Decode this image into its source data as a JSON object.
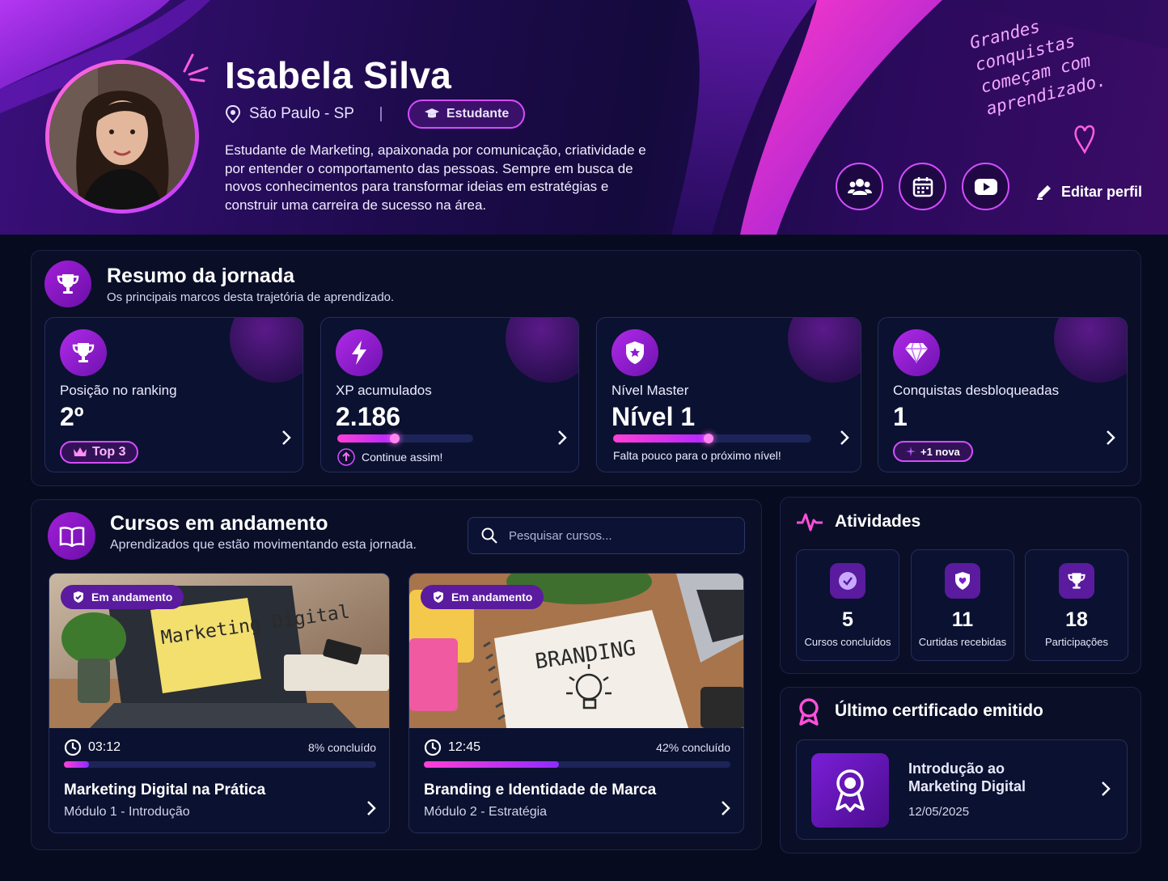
{
  "profile": {
    "name": "Isabela Silva",
    "location": "São Paulo - SP",
    "role_badge": "Estudante",
    "bio": "Estudante de Marketing, apaixonada por comunicação, criatividade e por entender o comportamento das pessoas. Sempre em busca de novos conhecimentos para transformar ideias em estratégias e construir uma carreira de sucesso na área.",
    "quote": "Grandes conquistas começam com aprendizado.",
    "edit_label": "Editar perfil",
    "actions": [
      "users-icon",
      "calendar-icon",
      "youtube-icon"
    ]
  },
  "summary": {
    "title": "Resumo da jornada",
    "subtitle": "Os principais marcos desta trajetória de aprendizado.",
    "cards": [
      {
        "label": "Posição no ranking",
        "value": "2º",
        "pill": "Top 3",
        "icon": "trophy-icon"
      },
      {
        "label": "XP acumulados",
        "value": "2.186",
        "hint": "Continue assim!",
        "progress": 0.42,
        "icon": "lightning-icon"
      },
      {
        "label": "Nível Master",
        "value": "Nível 1",
        "hint": "Falta pouco para o próximo nível!",
        "progress": 0.48,
        "icon": "shield-icon"
      },
      {
        "label": "Conquistas desbloqueadas",
        "value": "1",
        "pill": "+1 nova",
        "icon": "diamond-icon"
      }
    ]
  },
  "courses": {
    "title": "Cursos em andamento",
    "subtitle": "Aprendizados que estão movimentando esta jornada.",
    "search_placeholder": "Pesquisar cursos...",
    "items": [
      {
        "tag": "Em andamento",
        "thumb_text": "Marketing Digital",
        "time": "03:12",
        "progress_label": "8% concluído",
        "progress": 0.08,
        "title": "Marketing Digital na Prática",
        "module": "Módulo 1  -  Introdução"
      },
      {
        "tag": "Em andamento",
        "thumb_text": "BRANDING",
        "time": "12:45",
        "progress_label": "42% concluído",
        "progress": 0.44,
        "title": "Branding e Identidade de Marca",
        "module": "Módulo 2  -  Estratégia"
      }
    ]
  },
  "activities": {
    "title": "Atividades",
    "items": [
      {
        "number": "5",
        "label": "Cursos concluídos",
        "icon": "check-badge-icon"
      },
      {
        "number": "11",
        "label": "Curtidas recebidas",
        "icon": "shield-heart-icon"
      },
      {
        "number": "18",
        "label": "Participações",
        "icon": "trophy-icon"
      }
    ]
  },
  "certificate": {
    "title": "Último certificado emitido",
    "name": "Introdução ao Marketing Digital",
    "date": "12/05/2025"
  },
  "colors": {
    "accent": "#d54dff",
    "bg": "#070b1f",
    "panel": "#0a0f27"
  }
}
